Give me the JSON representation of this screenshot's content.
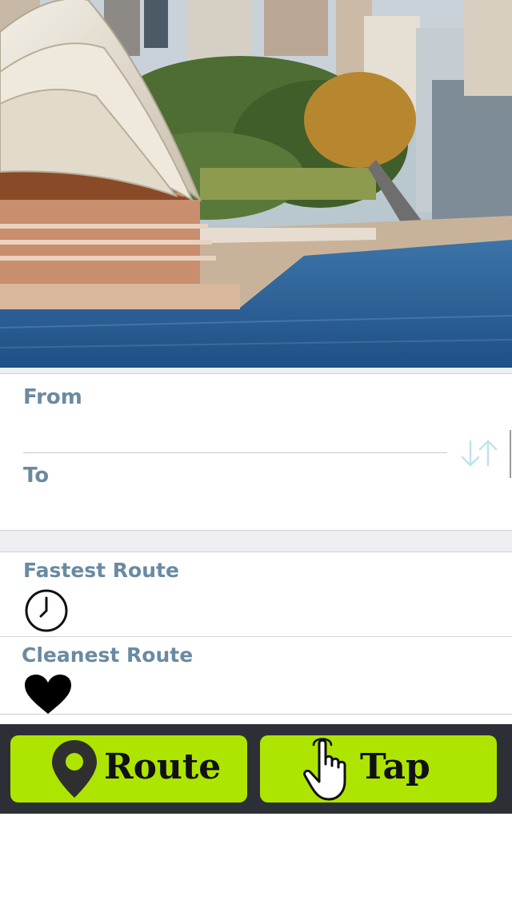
{
  "hero": {
    "image": "sydney-opera-house-harbour-photo"
  },
  "route_form": {
    "from_label": "From",
    "from_value": "",
    "to_label": "To",
    "to_value": "",
    "swap_icon": "swap-arrows-icon"
  },
  "options": [
    {
      "label": "Fastest Route",
      "icon": "clock-icon"
    },
    {
      "label": "Cleanest Route",
      "icon": "heart-icon"
    }
  ],
  "toolbar": {
    "route_label": "Route",
    "route_icon": "map-pin-icon",
    "tap_label": "Tap",
    "tap_icon": "pointing-hand-icon"
  },
  "colors": {
    "label_blue": "#6a8aa2",
    "button_green": "#aee500",
    "toolbar_dark": "#2c3036",
    "gap_gray": "#eeeef3"
  }
}
